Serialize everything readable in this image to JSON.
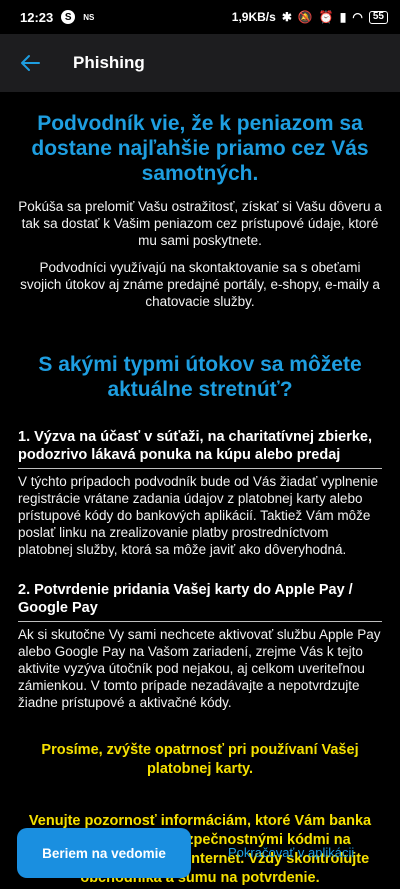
{
  "status": {
    "time": "12:23",
    "app_icon": "S",
    "ns": "NS",
    "speed": "1,9KB/s",
    "battery": "55"
  },
  "app_bar": {
    "title": "Phishing"
  },
  "content": {
    "heading1": "Podvodník vie, že k peniazom sa dostane najľahšie priamo cez Vás samotných.",
    "para1": "Pokúša sa prelomiť Vašu ostražitosť, získať si Vašu dôveru a tak sa dostať k Vašim peniazom cez prístupové údaje, ktoré mu sami poskytnete.",
    "para2": "Podvodníci využívajú na skontaktovanie sa s obeťami svojich útokov aj známe predajné portály, e-shopy, e-maily a chatovacie služby.",
    "heading2": "S akými typmi útokov sa môžete aktuálne stretnúť?",
    "sections": [
      {
        "title": "1. Výzva na účasť v súťaži, na charitatívnej zbierke, podozrivo lákavá ponuka na kúpu alebo predaj",
        "body": "V týchto prípadoch podvodník bude od Vás žiadať vyplnenie registrácie vrátane zadania údajov z platobnej karty alebo prístupové kódy do bankových aplikácií. Taktiež Vám môže poslať linku na zrealizovanie platby prostredníctvom platobnej služby, ktorá sa môže javiť ako dôveryhodná."
      },
      {
        "title": "2. Potvrdenie pridania Vašej karty do Apple Pay / Google Pay",
        "body": "Ak si skutočne Vy sami nechcete aktivovať službu Apple Pay alebo Google Pay na Vašom zariadení, zrejme Vás k tejto aktivite vyzýva útočník pod nejakou, aj celkom uveriteľnou zámienkou. V tomto prípade nezadávajte a nepotvrdzujte žiadne prístupové a aktivačné kódy."
      }
    ],
    "warning1": "Prosíme, zvýšte opatrnosť pri používaní Vašej platobnej karty.",
    "warning2": "Venujte pozornosť informáciám, ktoré Vám banka doručuje spolu s bezpečnostnými kódmi na potvrdenie platieb cez internet. Vždy skontrolujte obchodníka a sumu na potvrdenie."
  },
  "bottom": {
    "primary_label": "Beriem na vedomie",
    "secondary_label": "Pokračovať v aplikácii"
  },
  "colors": {
    "accent": "#1e9ee0",
    "warning": "#f5e000",
    "button": "#1a8fe0"
  }
}
